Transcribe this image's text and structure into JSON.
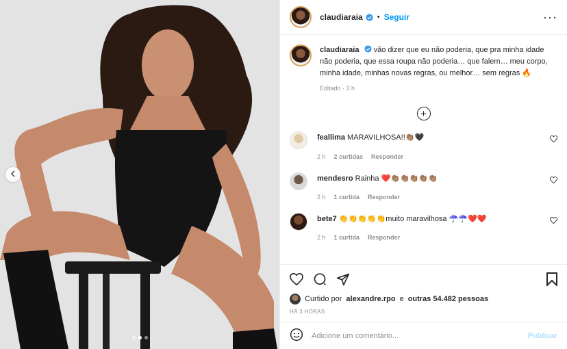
{
  "post": {
    "username": "claudiaraia",
    "follow_label": "Seguir",
    "more_label": "···",
    "caption": "vão dizer que eu não poderia, que pra minha idade não poderia, que essa roupa não poderia… que falem… meu corpo, minha idade, minhas novas regras, ou melhor… sem regras 🔥",
    "caption_meta": "Editado · 3 h",
    "load_more_label": "+"
  },
  "comments": [
    {
      "username": "feallima",
      "text": "MARAVILHOSA!!👏🏽🖤",
      "time": "2 h",
      "likes": "2 curtidas",
      "reply": "Responder"
    },
    {
      "username": "mendesro",
      "text": "Rainha ❤️👏🏽👏🏽👏🏽👏🏽👏🏽",
      "time": "2 h",
      "likes": "1 curtida",
      "reply": "Responder"
    },
    {
      "username": "bete7",
      "text": "👏👏👏👏👏muito maravilhosa ☂️☂️❤️❤️",
      "time": "2 h",
      "likes": "1 curtida",
      "reply": "Responder"
    }
  ],
  "actions": {
    "liked_prefix": "Curtido por",
    "liked_user": "alexandre.rpo",
    "liked_and": "e",
    "liked_others": "outras 54.482 pessoas",
    "time_ago": "HÁ 3 HORAS"
  },
  "comment_box": {
    "placeholder": "Adicione um comentário...",
    "publish_label": "Publicar"
  },
  "icons": {
    "like": "heart-icon",
    "comment": "comment-icon",
    "share": "share-icon",
    "save": "bookmark-icon",
    "emoji": "emoji-icon",
    "verified": "verified-badge-icon",
    "prev": "chevron-left-icon"
  },
  "colors": {
    "accent": "#0095f6",
    "muted": "#8e8e8e",
    "text": "#262626",
    "publish_disabled": "#b2dffc"
  }
}
